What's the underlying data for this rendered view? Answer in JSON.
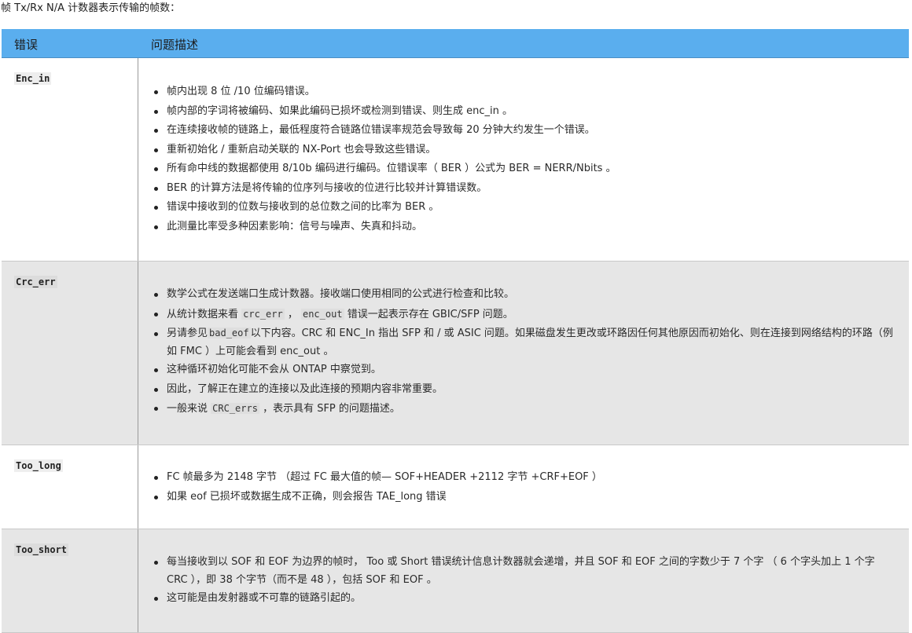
{
  "intro": "帧 Tx/Rx N/A 计数器表示传输的帧数：",
  "table": {
    "headers": {
      "error": "错误",
      "description": "问题描述"
    },
    "rows": [
      {
        "code": "Enc_in",
        "items": [
          "帧内出现 8 位 /10 位编码错误。",
          "帧内部的字词将被编码、如果此编码已损坏或检测到错误、则生成 enc_in 。",
          "在连续接收帧的链路上，最低程度符合链路位错误率规范会导致每 20 分钟大约发生一个错误。",
          "重新初始化 / 重新启动关联的 NX-Port 也会导致这些错误。",
          "所有命中线的数据都使用 8/10b 编码进行编码。位错误率（ BER ）公式为 BER = NERR/Nbits 。",
          "BER 的计算方法是将传输的位序列与接收的位进行比较并计算错误数。",
          "错误中接收到的位数与接收到的总位数之间的比率为 BER 。",
          "此测量比率受多种因素影响：信号与噪声、失真和抖动。"
        ]
      },
      {
        "code": "Crc_err",
        "items": [
          {
            "text": "数学公式在发送端口生成计数器。接收端口使用相同的公式进行检查和比较。"
          },
          {
            "pre": "从统计数据来看 ",
            "code1": "crc_err",
            "mid": " ， ",
            "code2": "enc_out",
            "post": " 错误一起表示存在 GBIC/SFP 问题。"
          },
          {
            "pre": "另请参见",
            "code1": "bad_eof",
            "post": "以下内容。CRC 和 ENC_In 指出 SFP 和 / 或 ASIC 问题。如果磁盘发生更改或环路因任何其他原因而初始化、则在连接到网络结构的环路（例如 FMC ）上可能会看到 enc_out 。"
          },
          {
            "text": "这种循环初始化可能不会从 ONTAP 中察觉到。"
          },
          {
            "text": "因此，了解正在建立的连接以及此连接的预期内容非常重要。"
          },
          {
            "pre": "一般来说 ",
            "code1": "CRC_errs",
            "post": " ，表示具有 SFP 的问题描述。"
          }
        ]
      },
      {
        "code": "Too_long",
        "items": [
          "FC 帧最多为 2148 字节 （超过 FC 最大值的帧— SOF+HEADER +2112 字节 +CRF+EOF ）",
          "如果 eof 已损坏或数据生成不正确，则会报告 TAE_long 错误"
        ]
      },
      {
        "code": "Too_short",
        "items": [
          "每当接收到以 SOF 和 EOF 为边界的帧时， Too 或 Short 错误统计信息计数器就会递增，并且 SOF 和 EOF 之间的字数少于 7 个字 （ 6 个字头加上 1 个字 CRC ），即 38 个字节（而不是 48 ），包括 SOF 和 EOF 。",
          "这可能是由发射器或不可靠的链路引起的。"
        ]
      }
    ]
  }
}
